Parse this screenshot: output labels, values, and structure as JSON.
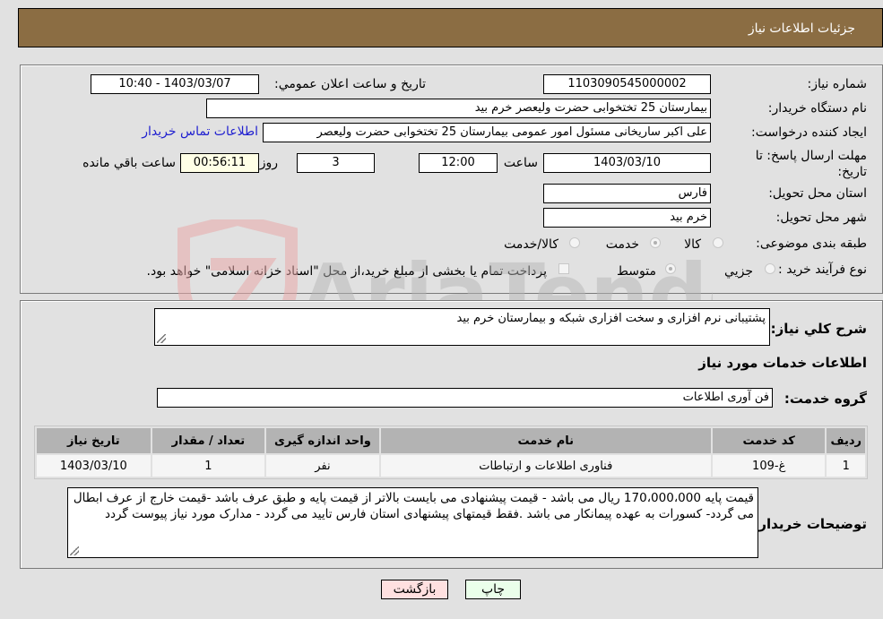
{
  "header": {
    "title": "جزئيات اطلاعات نياز"
  },
  "details": {
    "need_number_label": "شماره نياز:",
    "need_number": "1103090545000002",
    "announce_label": "تاريخ و ساعت اعلان عمومي:",
    "announce_value": "1403/03/07 - 10:40",
    "buyer_org_label": "نام دستگاه خريدار:",
    "buyer_org": "بیمارستان 25 تختخوابی حضرت ولیعصر خرم بید",
    "creator_label": "ايجاد کننده درخواست:",
    "creator": "علی اکبر ساریخانی مسئول امور عمومی بیمارستان 25 تختخوابی حضرت ولیعصر",
    "contact_link": "اطلاعات تماس خريدار",
    "deadline_label": "مهلت ارسال پاسخ: تا تاريخ:",
    "deadline_date": "1403/03/10",
    "time_label": "ساعت",
    "deadline_time": "12:00",
    "days_value": "3",
    "days_label": "روز و",
    "remaining_value": "00:56:11",
    "remaining_label": "ساعت باقي مانده",
    "province_label": "استان محل تحويل:",
    "province": "فارس",
    "city_label": "شهر محل تحويل:",
    "city": "خرم بید",
    "category_label": "طبقه بندی موضوعی:",
    "category_options": [
      {
        "label": "کالا",
        "checked": false
      },
      {
        "label": "خدمت",
        "checked": true
      },
      {
        "label": "کالا/خدمت",
        "checked": false
      }
    ],
    "purchase_type_label": "نوع فرآيند خريد :",
    "purchase_type_options": [
      {
        "label": "جزيي",
        "checked": false
      },
      {
        "label": "متوسط",
        "checked": true
      }
    ],
    "payment_note": "پرداخت تمام يا بخشی از مبلغ خريد،از محل \"اسناد خزانه اسلامی\" خواهد بود.",
    "payment_checked": false
  },
  "need": {
    "summary_label": "شرح کلي نياز:",
    "summary": "پشتیبانی نرم افزاری و سخت افزاری شبکه و بیمارستان خرم بید",
    "services_title": "اطلاعات خدمات مورد نياز",
    "service_group_label": "گروه خدمت:",
    "service_group": "فن آوری اطلاعات",
    "table": {
      "headers": [
        "رديف",
        "کد خدمت",
        "نام خدمت",
        "واحد اندازه گيری",
        "تعداد / مقدار",
        "تاريخ نياز"
      ],
      "rows": [
        [
          "1",
          "غ-109",
          "فناوری اطلاعات و ارتباطات",
          "نفر",
          "1",
          "1403/03/10"
        ]
      ]
    },
    "buyer_notes_label": "توضيحات خريدار:",
    "buyer_notes": "قیمت پایه 170،000،000 ریال می باشد - قیمت پیشنهادی می بایست بالاتر از قیمت پایه و طبق عرف باشد -قیمت خارج از عرف ابطال می گردد- کسورات به عهده پیمانکار می باشد .فقط قیمتهای پیشنهادی استان فارس تایید می گردد - مدارک مورد نیاز پیوست گردد"
  },
  "buttons": {
    "print": "چاپ",
    "back": "بازگشت"
  },
  "watermark": {
    "text": "AriaTender.neT"
  },
  "colors": {
    "header_bg": "#8b6d43",
    "print_bg": "#eaffea",
    "back_bg": "#ffe0e0",
    "link": "#2020d0"
  }
}
